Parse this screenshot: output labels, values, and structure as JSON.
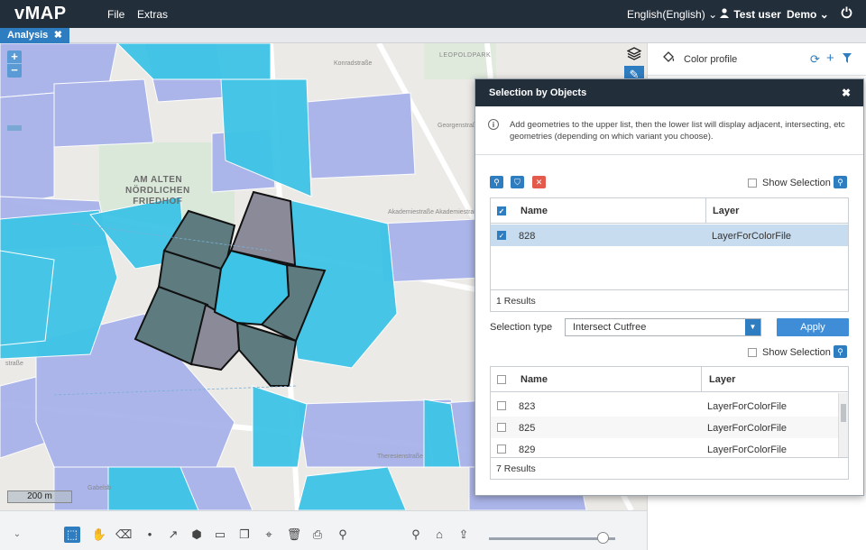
{
  "app": {
    "title": "vMAP",
    "menu": [
      "File",
      "Extras"
    ],
    "language": "English(English)",
    "user": "Test user",
    "project": "Demo"
  },
  "tab": {
    "label": "Analysis"
  },
  "map": {
    "zoom_in": "+",
    "zoom_out": "−",
    "scale": "200 m",
    "labels": {
      "cemetery": "AM ALTEN\nNÖRDLICHEN\nFRIEDHOF",
      "park": "LEOPOLDPARK",
      "street_konrad": "Konradstraße",
      "street_akademie": "Akademiestraße Akademiestraße",
      "street_georgen": "Georgenstraße",
      "street_theresien": "Theresienstraße",
      "street_gabels": "Gabelsb",
      "street_strasse": "straße"
    }
  },
  "colors": {
    "topbar": "#232e3b",
    "accent": "#2f7dc1",
    "parcel_blue": "#a8b3ea",
    "parcel_cyan": "#3ec4e6",
    "selected": "#5e7c80",
    "adjacent": "#8a8a98"
  },
  "side_panel": {
    "title": "Color profile"
  },
  "dialog": {
    "title": "Selection by Objects",
    "info": "Add geometries to the upper list, then the lower list will display adjacent, intersecting, etc geometries (depending on which variant you choose).",
    "show_selection": "Show Selection",
    "upper": {
      "columns": [
        "Name",
        "Layer"
      ],
      "rows": [
        {
          "name": "828",
          "layer": "LayerForColorFile",
          "checked": true
        }
      ],
      "footer": "1  Results"
    },
    "selection_type_label": "Selection type",
    "selection_type_value": "Intersect Cutfree",
    "apply": "Apply",
    "lower": {
      "columns": [
        "Name",
        "Layer"
      ],
      "rows": [
        {
          "name": "823",
          "layer": "LayerForColorFile"
        },
        {
          "name": "825",
          "layer": "LayerForColorFile"
        },
        {
          "name": "829",
          "layer": "LayerForColorFile"
        }
      ],
      "footer": "7  Results"
    }
  },
  "icons": {
    "logout": "power-icon",
    "user": "user-icon",
    "layers": "layers-icon",
    "paint": "paint-bucket-icon",
    "refresh": "refresh-icon",
    "add": "plus-icon",
    "filter": "filter-icon"
  }
}
